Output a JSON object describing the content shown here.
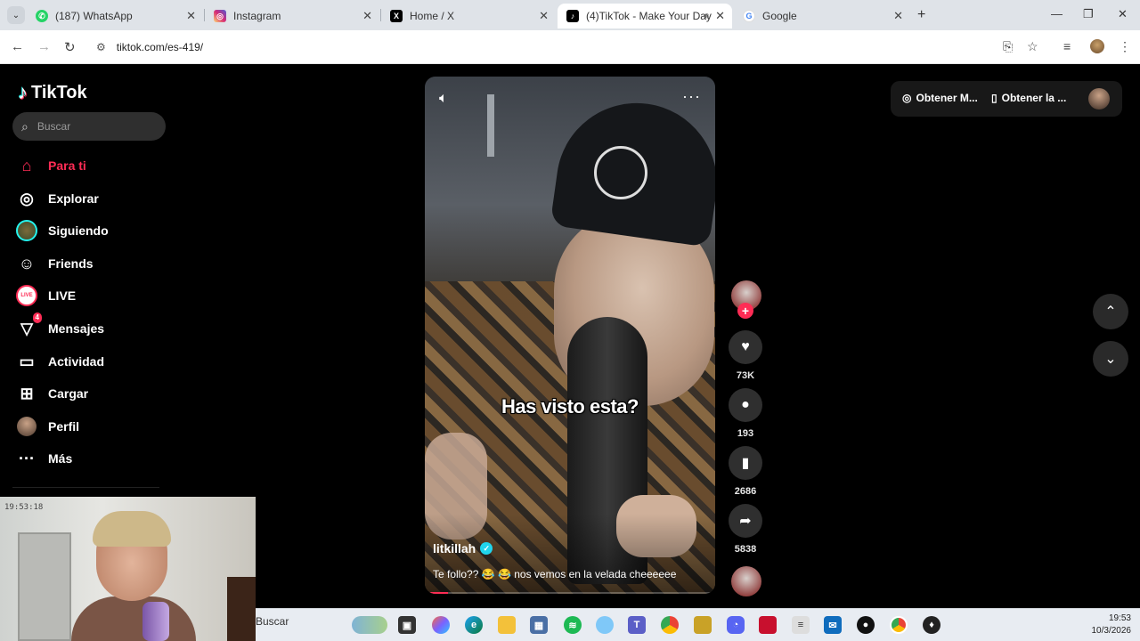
{
  "browser": {
    "tabs": [
      {
        "title": "(187) WhatsApp",
        "icon": "whatsapp-icon",
        "color": "#25d366"
      },
      {
        "title": "Instagram",
        "icon": "instagram-icon",
        "color": "#d62976"
      },
      {
        "title": "Home / X",
        "icon": "x-icon",
        "color": "#000000"
      },
      {
        "title": "(4)TikTok - Make Your Day",
        "icon": "tiktok-icon",
        "color": "#000000",
        "active": true
      },
      {
        "title": "Google",
        "icon": "google-icon",
        "color": "#4285f4"
      }
    ],
    "url": "tiktok.com/es-419/"
  },
  "tiktok": {
    "logo": "TikTok",
    "search_placeholder": "Buscar",
    "nav": [
      {
        "label": "Para ti",
        "icon": "home-icon",
        "active": true
      },
      {
        "label": "Explorar",
        "icon": "compass-icon"
      },
      {
        "label": "Siguiendo",
        "icon": "following-avatar-icon"
      },
      {
        "label": "Friends",
        "icon": "friends-icon"
      },
      {
        "label": "LIVE",
        "icon": "live-icon"
      },
      {
        "label": "Mensajes",
        "icon": "messages-icon",
        "badge": "4"
      },
      {
        "label": "Actividad",
        "icon": "activity-icon"
      },
      {
        "label": "Cargar",
        "icon": "upload-icon"
      },
      {
        "label": "Perfil",
        "icon": "profile-avatar-icon"
      },
      {
        "label": "Más",
        "icon": "more-icon"
      }
    ],
    "top_actions": {
      "item1": "Obtener M...",
      "item2": "Obtener la ..."
    },
    "video": {
      "caption": "Has visto esta?",
      "author": "litkillah",
      "description": "Te follo?? 😂 😂 nos vemos en la velada cheeeeee",
      "progress": 0.08
    },
    "actions": {
      "likes": "73K",
      "comments": "193",
      "saves": "2686",
      "shares": "5838"
    }
  },
  "webcam": {
    "timestamp": "19:53:18"
  },
  "taskbar": {
    "search": "Buscar",
    "time": "19:53",
    "date": "10/3/2026"
  }
}
